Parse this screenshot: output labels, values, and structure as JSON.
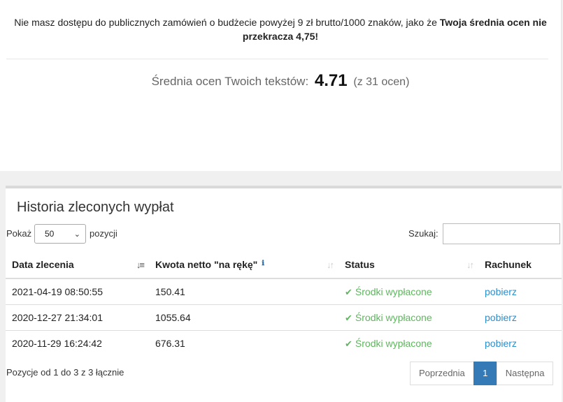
{
  "notice": {
    "text": "Nie masz dostępu do publicznych zamówień o budżecie powyżej 9 zł brutto/1000 znaków, jako że ",
    "bold": "Twoja średnia ocen nie przekracza 4,75!"
  },
  "average": {
    "label": "Średnia ocen Twoich tekstów:",
    "value": "4.71",
    "count": "(z 31 ocen)"
  },
  "history": {
    "title": "Historia zleconych wypłat",
    "show_label": "Pokaż",
    "page_size": "50",
    "entries_label": "pozycji",
    "search_label": "Szukaj:",
    "search_value": "",
    "columns": [
      "Data zlecenia",
      "Kwota netto \"na rękę\"",
      "Status",
      "Rachunek"
    ],
    "info_icon": "ℹ",
    "rows": [
      {
        "date": "2021-04-19 08:50:55",
        "amount": "150.41",
        "status": "Środki wypłacone",
        "invoice": "pobierz"
      },
      {
        "date": "2020-12-27 21:34:01",
        "amount": "1055.64",
        "status": "Środki wypłacone",
        "invoice": "pobierz"
      },
      {
        "date": "2020-11-29 16:24:42",
        "amount": "676.31",
        "status": "Środki wypłacone",
        "invoice": "pobierz"
      }
    ],
    "info": "Pozycje od 1 do 3 z 3 łącznie",
    "pagination": {
      "prev": "Poprzednia",
      "current": "1",
      "next": "Następna"
    }
  },
  "colors": {
    "accent": "#337ab7",
    "success": "#5cb85c",
    "link": "#2a8fce"
  },
  "icons": {
    "status": "check-icon",
    "sort": "sort-icon",
    "info": "info-icon",
    "select": "chevron-down-icon"
  }
}
